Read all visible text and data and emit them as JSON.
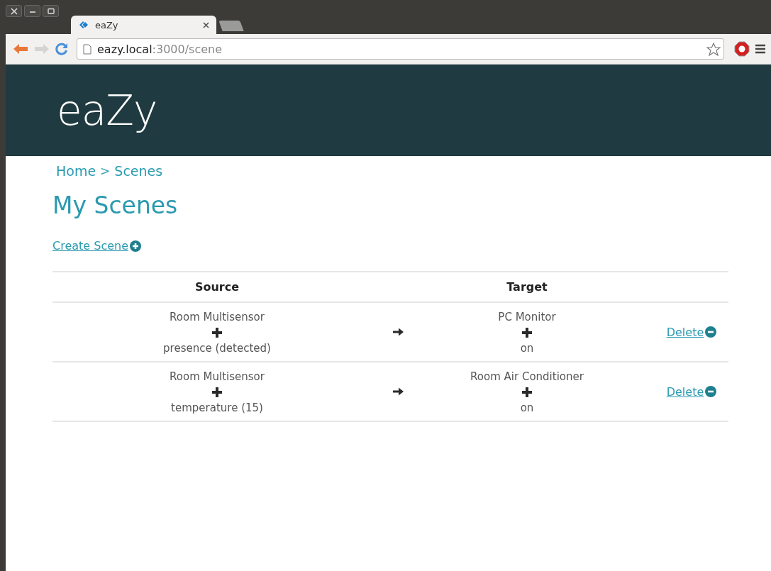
{
  "browser": {
    "tab": {
      "title": "eaZy",
      "selected": true
    },
    "url": {
      "host": "eazy.local",
      "path": ":3000/scene"
    }
  },
  "header": {
    "logo": "eaZy"
  },
  "breadcrumb": [
    {
      "label": "Home"
    },
    {
      "label": ">",
      "kind": "separator"
    },
    {
      "label": "Scenes"
    }
  ],
  "page_title": "My Scenes",
  "create_link": "Create Scene",
  "table": {
    "columns": [
      "Source",
      "",
      "Target",
      ""
    ],
    "rows": [
      {
        "source": "Room Multisensor",
        "source_condition": "presence (detected)",
        "target": "PC Monitor",
        "target_action": "on",
        "delete": "Delete"
      },
      {
        "source": "Room Multisensor",
        "source_condition": "temperature (15)",
        "target": "Room Air Conditioner",
        "target_action": "on",
        "delete": "Delete"
      }
    ]
  }
}
